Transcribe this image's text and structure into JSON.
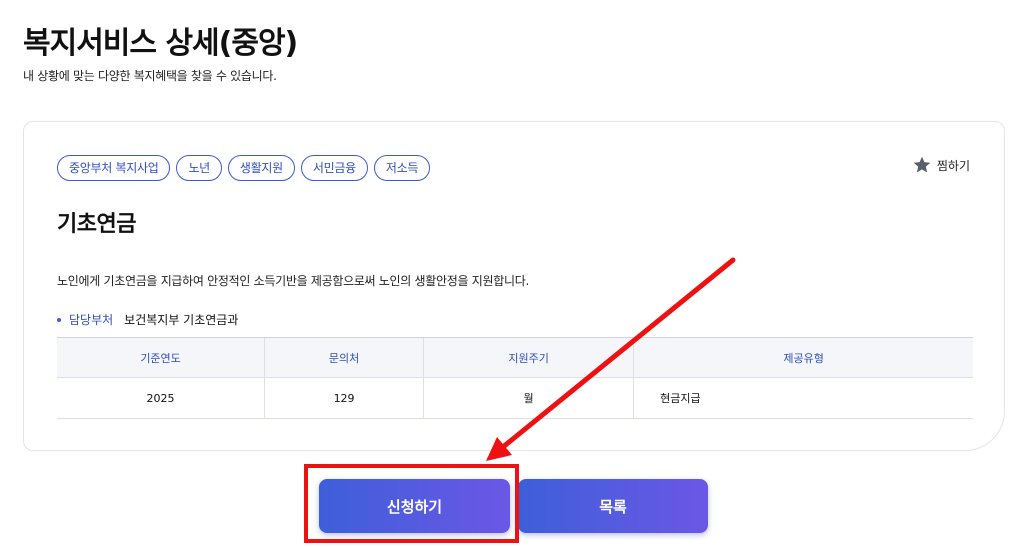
{
  "header": {
    "title": "복지서비스 상세(중앙)",
    "subtitle": "내 상황에 맞는 다양한 복지혜택을 찾을 수 있습니다."
  },
  "card": {
    "tags": [
      "중앙부처 복지사업",
      "노년",
      "생활지원",
      "서민금융",
      "저소득"
    ],
    "favorite_label": "찜하기",
    "service_name": "기초연금",
    "description": "노인에게 기초연금을 지급하여 안정적인 소득기반을 제공함으로써 노인의 생활안정을 지원합니다.",
    "department": {
      "label": "담당부처",
      "value": "보건복지부 기초연금과"
    },
    "table": {
      "headers": [
        "기준연도",
        "문의처",
        "지원주기",
        "제공유형"
      ],
      "row": [
        "2025",
        "129",
        "월",
        "현금지급"
      ]
    }
  },
  "buttons": {
    "apply_label": "신청하기",
    "list_label": "목록"
  },
  "colors": {
    "accent": "#3b5bdb",
    "button_gradient_start": "#3e5fd9",
    "button_gradient_end": "#6b57e6",
    "annotation_red": "#ee1111"
  }
}
